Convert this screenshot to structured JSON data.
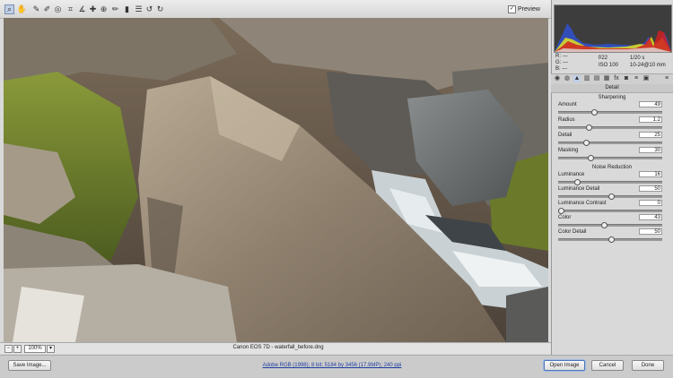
{
  "toolbar": {
    "tools": [
      "zoom-icon",
      "hand-icon",
      "eyedropper-icon",
      "color-sampler-icon",
      "crop-icon",
      "straighten-icon",
      "spot-removal-icon",
      "redeye-icon",
      "brush-icon",
      "graduated-filter-icon",
      "preferences-icon",
      "rotate-left-icon",
      "rotate-right-icon"
    ],
    "preview_label": "Preview",
    "preview_checked": true
  },
  "statusbar": {
    "zoom": "100%",
    "caption": "Canon EOS 7D  -  waterfall_before.dng"
  },
  "readout": {
    "r_label": "R:",
    "r_value": "---",
    "g_label": "G:",
    "g_value": "---",
    "b_label": "B:",
    "b_value": "---",
    "aperture": "f/22",
    "shutter": "1/20 s",
    "iso": "ISO 100",
    "lens": "10-24@10 mm"
  },
  "panel": {
    "title": "Detail",
    "sharpening_title": "Sharpening",
    "noise_title": "Noise Reduction",
    "sharpening": [
      {
        "label": "Amount",
        "value": "49",
        "fraction": 0.33
      },
      {
        "label": "Radius",
        "value": "1.2",
        "fraction": 0.28
      },
      {
        "label": "Detail",
        "value": "25",
        "fraction": 0.25
      },
      {
        "label": "Masking",
        "value": "30",
        "fraction": 0.3
      }
    ],
    "noise": [
      {
        "label": "Luminance",
        "value": "16",
        "fraction": 0.16
      },
      {
        "label": "Luminance Detail",
        "value": "50",
        "fraction": 0.5
      },
      {
        "label": "Luminance Contrast",
        "value": "0",
        "fraction": 0.0
      },
      {
        "label": "Color",
        "value": "43",
        "fraction": 0.43
      },
      {
        "label": "Color Detail",
        "value": "50",
        "fraction": 0.5
      }
    ]
  },
  "bottom": {
    "save_label": "Save Image...",
    "workflow": "Adobe RGB (1998); 8 bit; 5184 by 3456 (17.9MP); 240 ppi",
    "open_label": "Open Image",
    "cancel_label": "Cancel",
    "done_label": "Done"
  },
  "colors": {
    "accent": "#4d76b8"
  }
}
